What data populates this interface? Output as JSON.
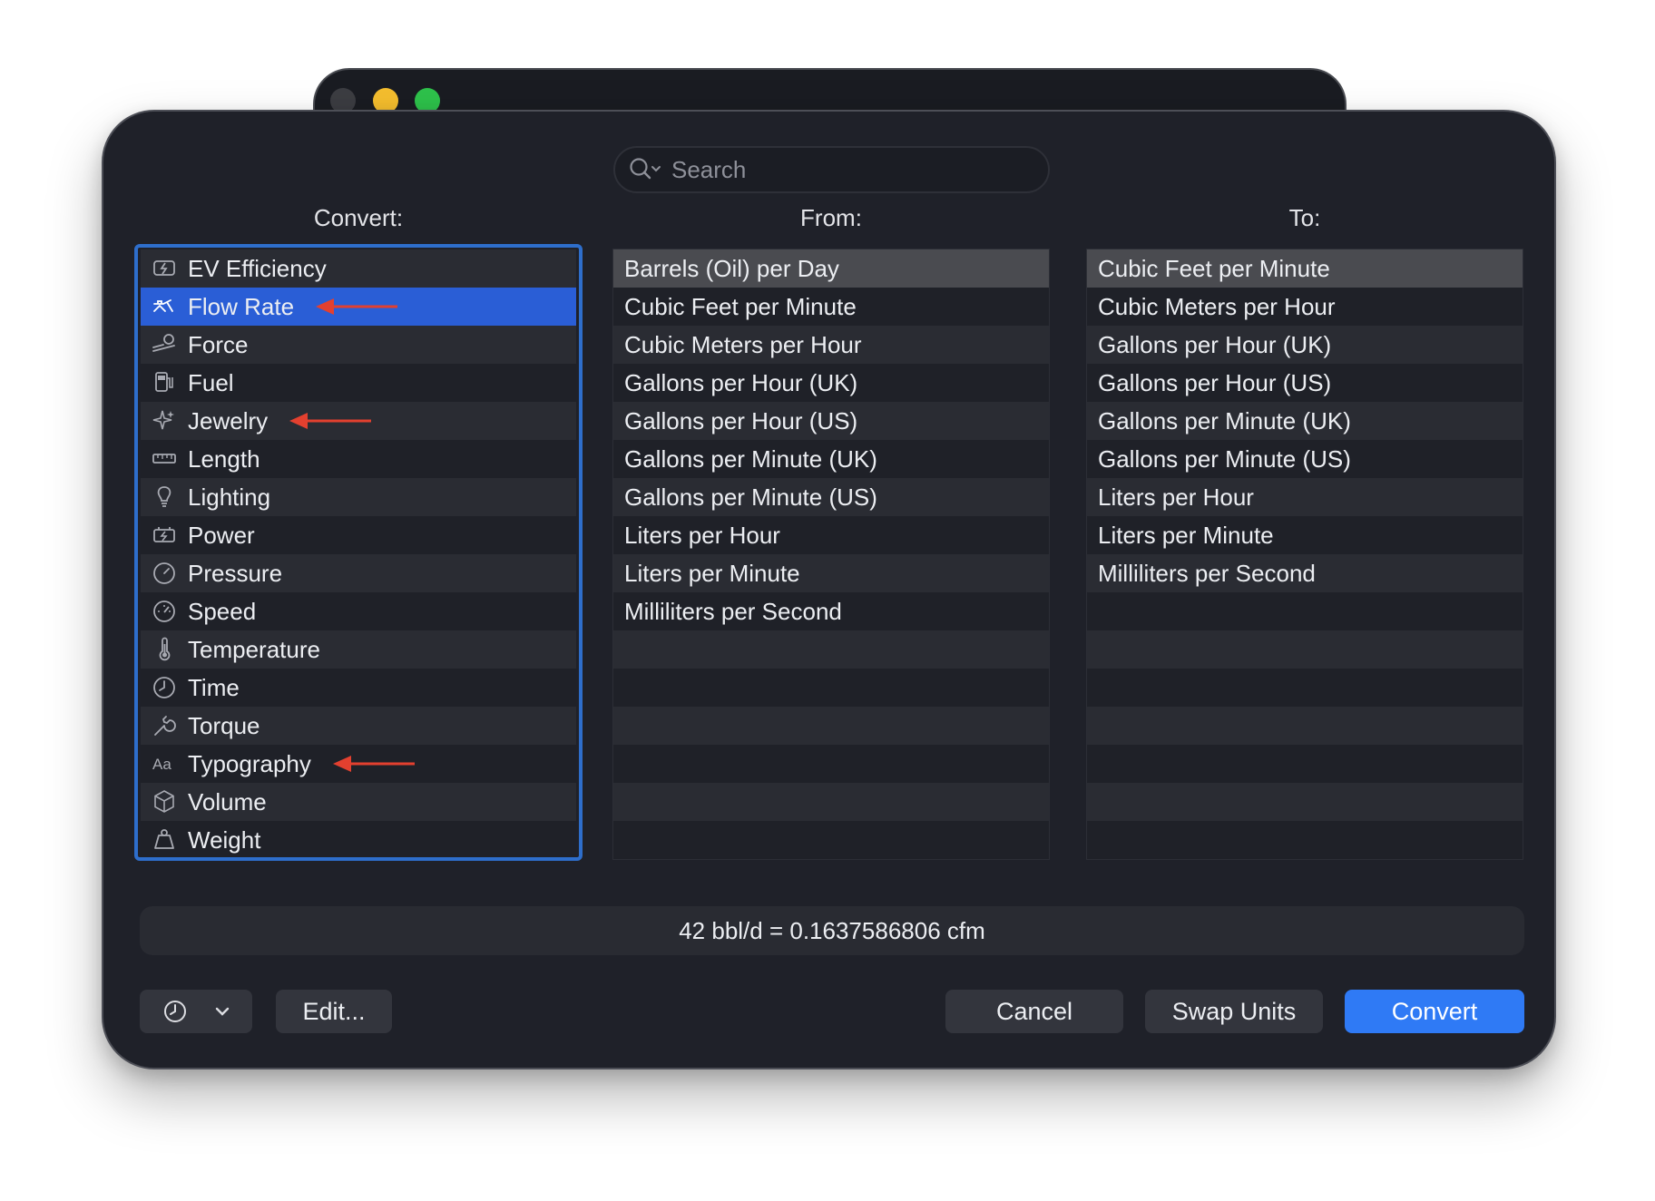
{
  "window": {
    "traffic_lights": [
      "gray",
      "yellow",
      "green"
    ]
  },
  "search": {
    "placeholder": "Search"
  },
  "headers": {
    "convert": "Convert:",
    "from": "From:",
    "to": "To:"
  },
  "convert_list": [
    {
      "label": "EV Efficiency",
      "icon": "ev-battery-icon"
    },
    {
      "label": "Flow Rate",
      "icon": "faucet-icon",
      "selected": true,
      "annotated": true
    },
    {
      "label": "Force",
      "icon": "force-icon"
    },
    {
      "label": "Fuel",
      "icon": "fuel-pump-icon"
    },
    {
      "label": "Jewelry",
      "icon": "sparkle-icon",
      "annotated": true
    },
    {
      "label": "Length",
      "icon": "ruler-icon"
    },
    {
      "label": "Lighting",
      "icon": "lightbulb-icon"
    },
    {
      "label": "Power",
      "icon": "battery-bolt-icon"
    },
    {
      "label": "Pressure",
      "icon": "gauge-icon"
    },
    {
      "label": "Speed",
      "icon": "speedometer-icon"
    },
    {
      "label": "Temperature",
      "icon": "thermometer-icon"
    },
    {
      "label": "Time",
      "icon": "clock-icon"
    },
    {
      "label": "Torque",
      "icon": "wrench-icon"
    },
    {
      "label": "Typography",
      "icon": "text-size-icon",
      "annotated": true
    },
    {
      "label": "Volume",
      "icon": "cube-icon"
    },
    {
      "label": "Weight",
      "icon": "weight-icon"
    }
  ],
  "from_list": [
    "Barrels (Oil) per Day",
    "Cubic Feet per Minute",
    "Cubic Meters per Hour",
    "Gallons per Hour (UK)",
    "Gallons per Hour (US)",
    "Gallons per Minute (UK)",
    "Gallons per Minute (US)",
    "Liters per Hour",
    "Liters per Minute",
    "Milliliters per Second"
  ],
  "to_list": [
    "Cubic Feet per Minute",
    "Cubic Meters per Hour",
    "Gallons per Hour (UK)",
    "Gallons per Hour (US)",
    "Gallons per Minute (UK)",
    "Gallons per Minute (US)",
    "Liters per Hour",
    "Liters per Minute",
    "Milliliters per Second"
  ],
  "result": "42 bbl/d = 0.1637586806 cfm",
  "buttons": {
    "edit": "Edit...",
    "cancel": "Cancel",
    "swap": "Swap Units",
    "convert": "Convert"
  },
  "colors": {
    "accent": "#2f7af5",
    "selection": "#2a5ed6",
    "annotation_arrow": "#e3402f"
  }
}
